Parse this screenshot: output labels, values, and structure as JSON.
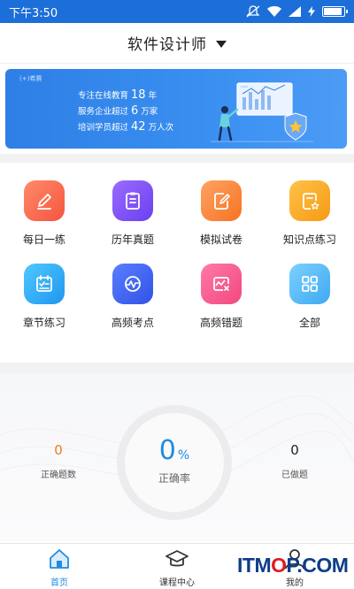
{
  "status_bar": {
    "time": "下午3:50",
    "background": "#1c6ed9"
  },
  "header": {
    "title": "软件设计师"
  },
  "banner": {
    "brand": "(+)希赛",
    "lines": [
      {
        "pre": "专注在线教育",
        "num": "18",
        "post": "年"
      },
      {
        "pre": "服务企业超过",
        "num": "6",
        "post": "万家"
      },
      {
        "pre": "培训学员超过",
        "num": "42",
        "post": "万人次"
      }
    ]
  },
  "grid": [
    {
      "label": "每日一练",
      "icon": "pencil-icon",
      "colors": [
        "#ff8a6a",
        "#f5553f"
      ]
    },
    {
      "label": "历年真题",
      "icon": "document-icon",
      "colors": [
        "#9b6cff",
        "#6a3ff0"
      ]
    },
    {
      "label": "模拟试卷",
      "icon": "edit-paper-icon",
      "colors": [
        "#ffa363",
        "#f57323"
      ]
    },
    {
      "label": "知识点练习",
      "icon": "star-paper-icon",
      "colors": [
        "#ffc24a",
        "#f59a12"
      ]
    },
    {
      "label": "章节练习",
      "icon": "checklist-icon",
      "colors": [
        "#4fc8ff",
        "#1f96f0"
      ]
    },
    {
      "label": "高频考点",
      "icon": "wave-chart-icon",
      "colors": [
        "#5a7dff",
        "#3153e8"
      ]
    },
    {
      "label": "高频错题",
      "icon": "error-chart-icon",
      "colors": [
        "#ff7aa8",
        "#f2477f"
      ]
    },
    {
      "label": "全部",
      "icon": "grid-icon",
      "colors": [
        "#7cd0ff",
        "#3ea9f2"
      ]
    }
  ],
  "stats": {
    "correct_count": {
      "value": "0",
      "label": "正确题数",
      "color": "#f07a1e"
    },
    "accuracy": {
      "value": "0",
      "unit": "%",
      "label": "正确率",
      "color": "#1f8ce0"
    },
    "done_count": {
      "value": "0",
      "label": "已做题",
      "color": "#222222"
    }
  },
  "tabbar": {
    "items": [
      {
        "label": "首页",
        "icon": "home-icon",
        "active": true
      },
      {
        "label": "课程中心",
        "icon": "graduation-cap-icon",
        "active": false
      },
      {
        "label": "我的",
        "icon": "user-icon",
        "active": false
      }
    ],
    "active_color": "#1f8ce0"
  },
  "watermark": {
    "pre": "ITM",
    "o": "O",
    "post": "P.COM"
  }
}
